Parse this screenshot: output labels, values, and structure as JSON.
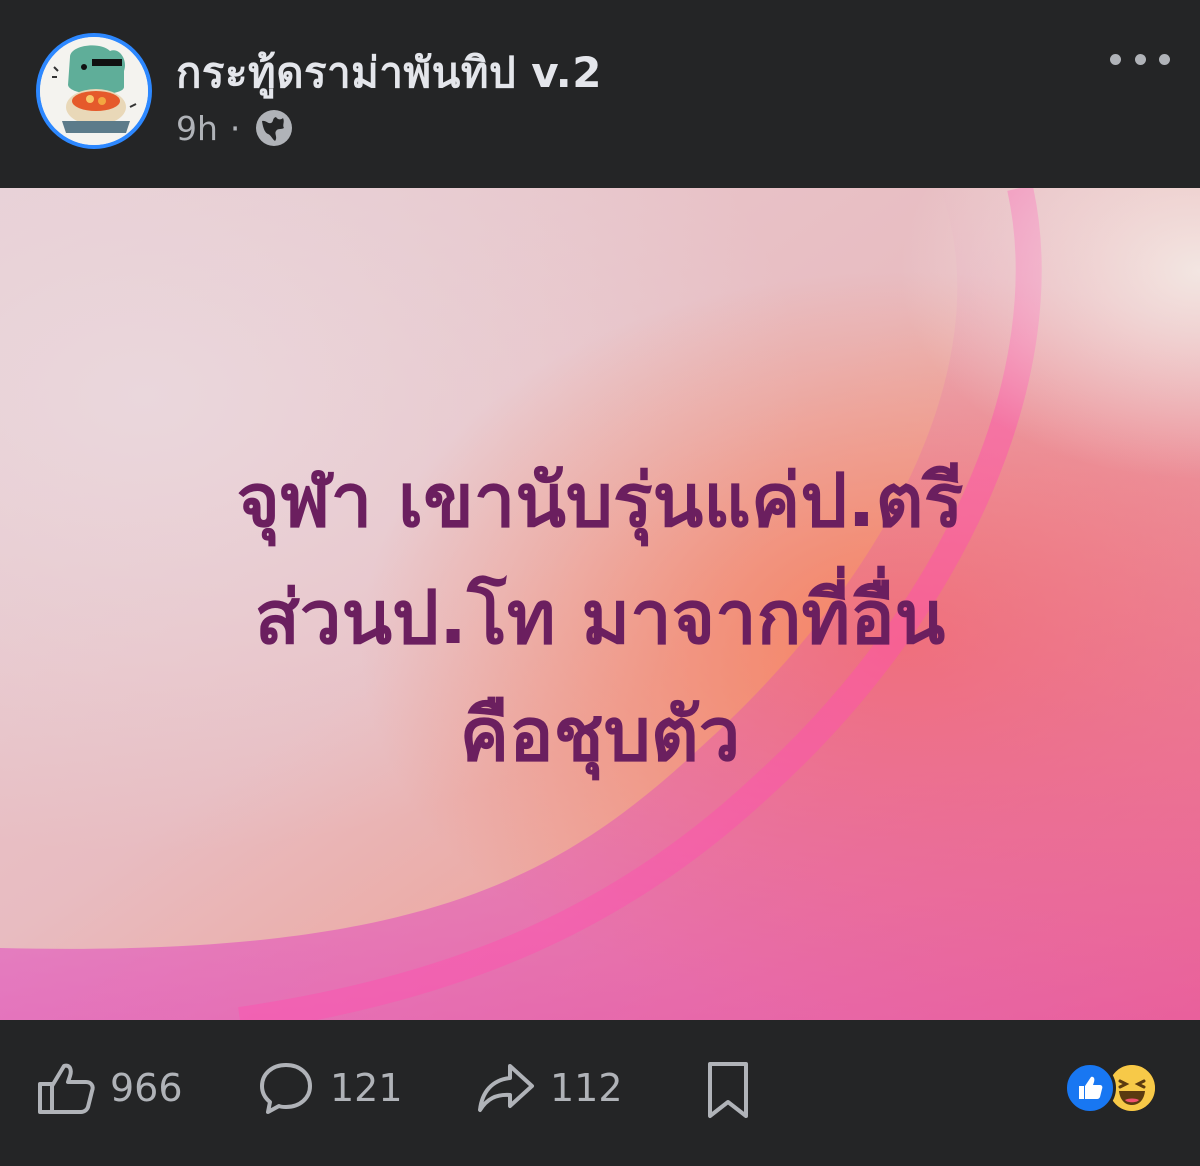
{
  "header": {
    "page_name": "กระทู้ดราม่าพันทิป v.2",
    "time": "9h",
    "dot": "·",
    "privacy_icon": "globe-icon",
    "more_icon": "more-horizontal-icon"
  },
  "post": {
    "lines": [
      "จุฬา เขานับรุ่นแค่ป.ตรี",
      "ส่วนป.โท มาจากที่อื่น",
      "คือชุบตัว"
    ],
    "text_color": "#6b1f5f"
  },
  "footer": {
    "like_count": "966",
    "comment_count": "121",
    "share_count": "112",
    "like_icon": "thumbs-up-icon",
    "comment_icon": "comment-icon",
    "share_icon": "share-arrow-icon",
    "save_icon": "bookmark-icon",
    "reactions": [
      "like-reaction-icon",
      "haha-reaction-icon"
    ]
  },
  "colors": {
    "background": "#242526",
    "text_primary": "#e4e6eb",
    "text_secondary": "#b0b3b8",
    "accent": "#2d88ff"
  }
}
